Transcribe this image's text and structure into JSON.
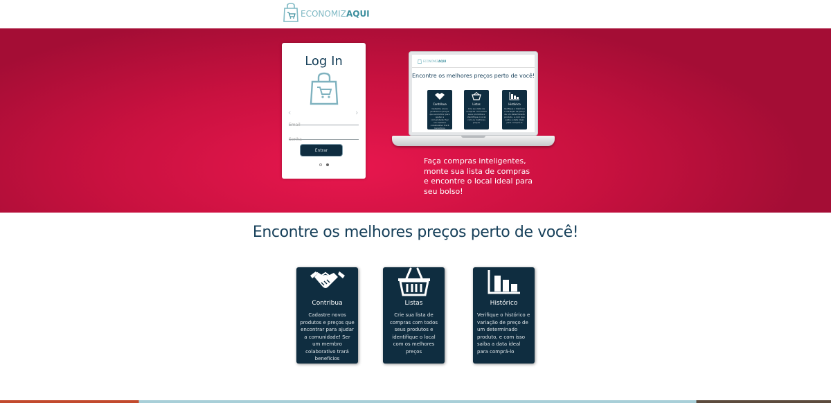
{
  "header": {
    "logo_part1": "ECONOMIZ",
    "logo_part2": "AQUI",
    "logo_icon": "shopping-bag-icon"
  },
  "login": {
    "title": "Log In",
    "email_placeholder": "Email",
    "password_placeholder": "Senha",
    "submit_label": "Entrar",
    "prev_arrow": "‹",
    "next_arrow": "›"
  },
  "laptop_preview": {
    "logo_part1": "ECONOMIZ",
    "logo_part2": "AQUI",
    "heading": "Encontre os melhores preços perto de você!",
    "cards": [
      {
        "title": "Contribua",
        "desc": "Cadastre novos produtos e preços que encontrar para ajudar a comunidade! Ser um membro colaborativo trará benefícios"
      },
      {
        "title": "Listas",
        "desc": "Crie sua lista de compras com todos seus produtos e identifique o local com os melhores preços"
      },
      {
        "title": "Histórico",
        "desc": "Verifique o histórico e variação de preço de um determinado produto, e com isso saiba a data ideal para comprá-lo"
      }
    ]
  },
  "hero": {
    "text": "Faça compras inteligentes, monte sua lista de compras e encontre o local ideal para seu bolso!"
  },
  "section": {
    "title": "Encontre os melhores preços perto de você!"
  },
  "features": [
    {
      "title": "Contribua",
      "icon": "handshake-icon",
      "desc": "Cadastre novos produtos e preços que encontrar para ajudar a comunidade! Ser um membro colaborativo trará benefícios"
    },
    {
      "title": "Listas",
      "icon": "basket-icon",
      "desc": "Crie sua lista de compras com todos seus produtos e identifique o local com os melhores preços"
    },
    {
      "title": "Histórico",
      "icon": "bar-chart-icon",
      "desc": "Verifique o histórico e variação de preço de um determinado produto, e com isso saiba a data ideal para comprá-lo"
    }
  ],
  "colors": {
    "hero": "#d3144a",
    "navy": "#0f2d40",
    "title": "#17405a",
    "brand_teal": "#3d8f9e"
  }
}
